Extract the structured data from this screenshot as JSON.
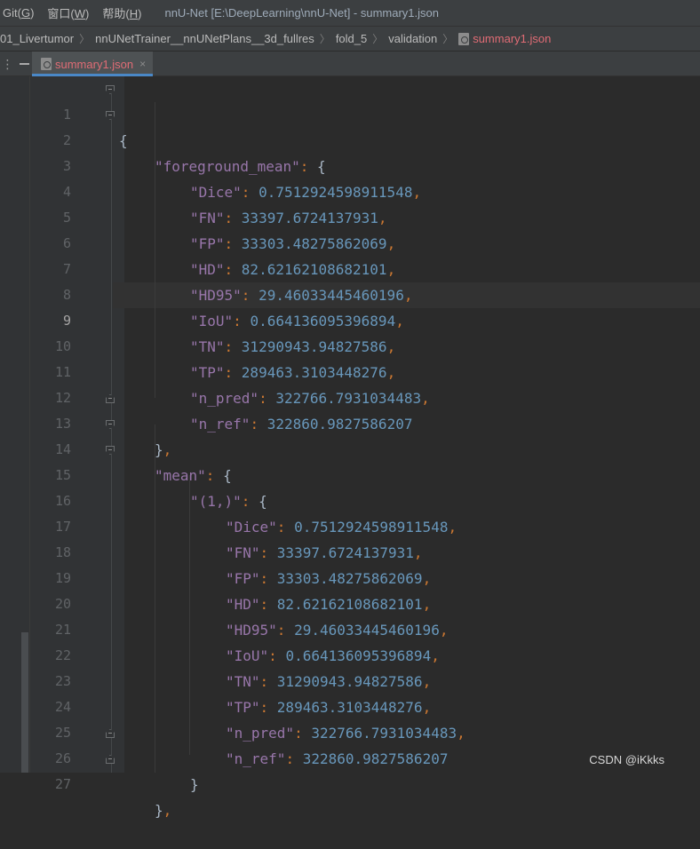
{
  "menubar": {
    "git": "Git(",
    "git_u": "G",
    "git_end": ")",
    "window": "窗口(",
    "window_u": "W",
    "window_end": ")",
    "help": "帮助(",
    "help_u": "H",
    "help_end": ")",
    "title": "nnU-Net [E:\\DeepLearning\\nnU-Net] - summary1.json"
  },
  "breadcrumb": {
    "items": [
      "01_Livertumor",
      "nnUNetTrainer__nnUNetPlans__3d_fullres",
      "fold_5",
      "validation"
    ],
    "active": "summary1.json"
  },
  "tab": {
    "label": "summary1.json",
    "close": "×"
  },
  "editor": {
    "current_line": 9,
    "lines": [
      {
        "n": "1"
      },
      {
        "n": "2"
      },
      {
        "n": "3"
      },
      {
        "n": "4"
      },
      {
        "n": "5"
      },
      {
        "n": "6"
      },
      {
        "n": "7"
      },
      {
        "n": "8"
      },
      {
        "n": "9"
      },
      {
        "n": "10"
      },
      {
        "n": "11"
      },
      {
        "n": "12"
      },
      {
        "n": "13"
      },
      {
        "n": "14"
      },
      {
        "n": "15"
      },
      {
        "n": "16"
      },
      {
        "n": "17"
      },
      {
        "n": "18"
      },
      {
        "n": "19"
      },
      {
        "n": "20"
      },
      {
        "n": "21"
      },
      {
        "n": "22"
      },
      {
        "n": "23"
      },
      {
        "n": "24"
      },
      {
        "n": "25"
      },
      {
        "n": "26"
      },
      {
        "n": "27"
      }
    ],
    "code": {
      "l2_key": "\"foreground_mean\"",
      "l14_key": "\"mean\"",
      "l15_key": "\"(1,)\"",
      "fg": [
        {
          "k": "\"Dice\"",
          "v": "0.7512924598911548"
        },
        {
          "k": "\"FN\"",
          "v": "33397.6724137931"
        },
        {
          "k": "\"FP\"",
          "v": "33303.48275862069"
        },
        {
          "k": "\"HD\"",
          "v": "82.62162108682101"
        },
        {
          "k": "\"HD95\"",
          "v": "29.46033445460196"
        },
        {
          "k": "\"IoU\"",
          "v": "0.664136095396894"
        },
        {
          "k": "\"TN\"",
          "v": "31290943.94827586"
        },
        {
          "k": "\"TP\"",
          "v": "289463.3103448276"
        },
        {
          "k": "\"n_pred\"",
          "v": "322766.7931034483"
        },
        {
          "k": "\"n_ref\"",
          "v": "322860.9827586207"
        }
      ],
      "mean": [
        {
          "k": "\"Dice\"",
          "v": "0.7512924598911548"
        },
        {
          "k": "\"FN\"",
          "v": "33397.6724137931"
        },
        {
          "k": "\"FP\"",
          "v": "33303.48275862069"
        },
        {
          "k": "\"HD\"",
          "v": "82.62162108682101"
        },
        {
          "k": "\"HD95\"",
          "v": "29.46033445460196"
        },
        {
          "k": "\"IoU\"",
          "v": "0.664136095396894"
        },
        {
          "k": "\"TN\"",
          "v": "31290943.94827586"
        },
        {
          "k": "\"TP\"",
          "v": "289463.3103448276"
        },
        {
          "k": "\"n_pred\"",
          "v": "322766.7931034483"
        },
        {
          "k": "\"n_ref\"",
          "v": "322860.9827586207"
        }
      ]
    }
  },
  "watermark": "CSDN @iKkks"
}
